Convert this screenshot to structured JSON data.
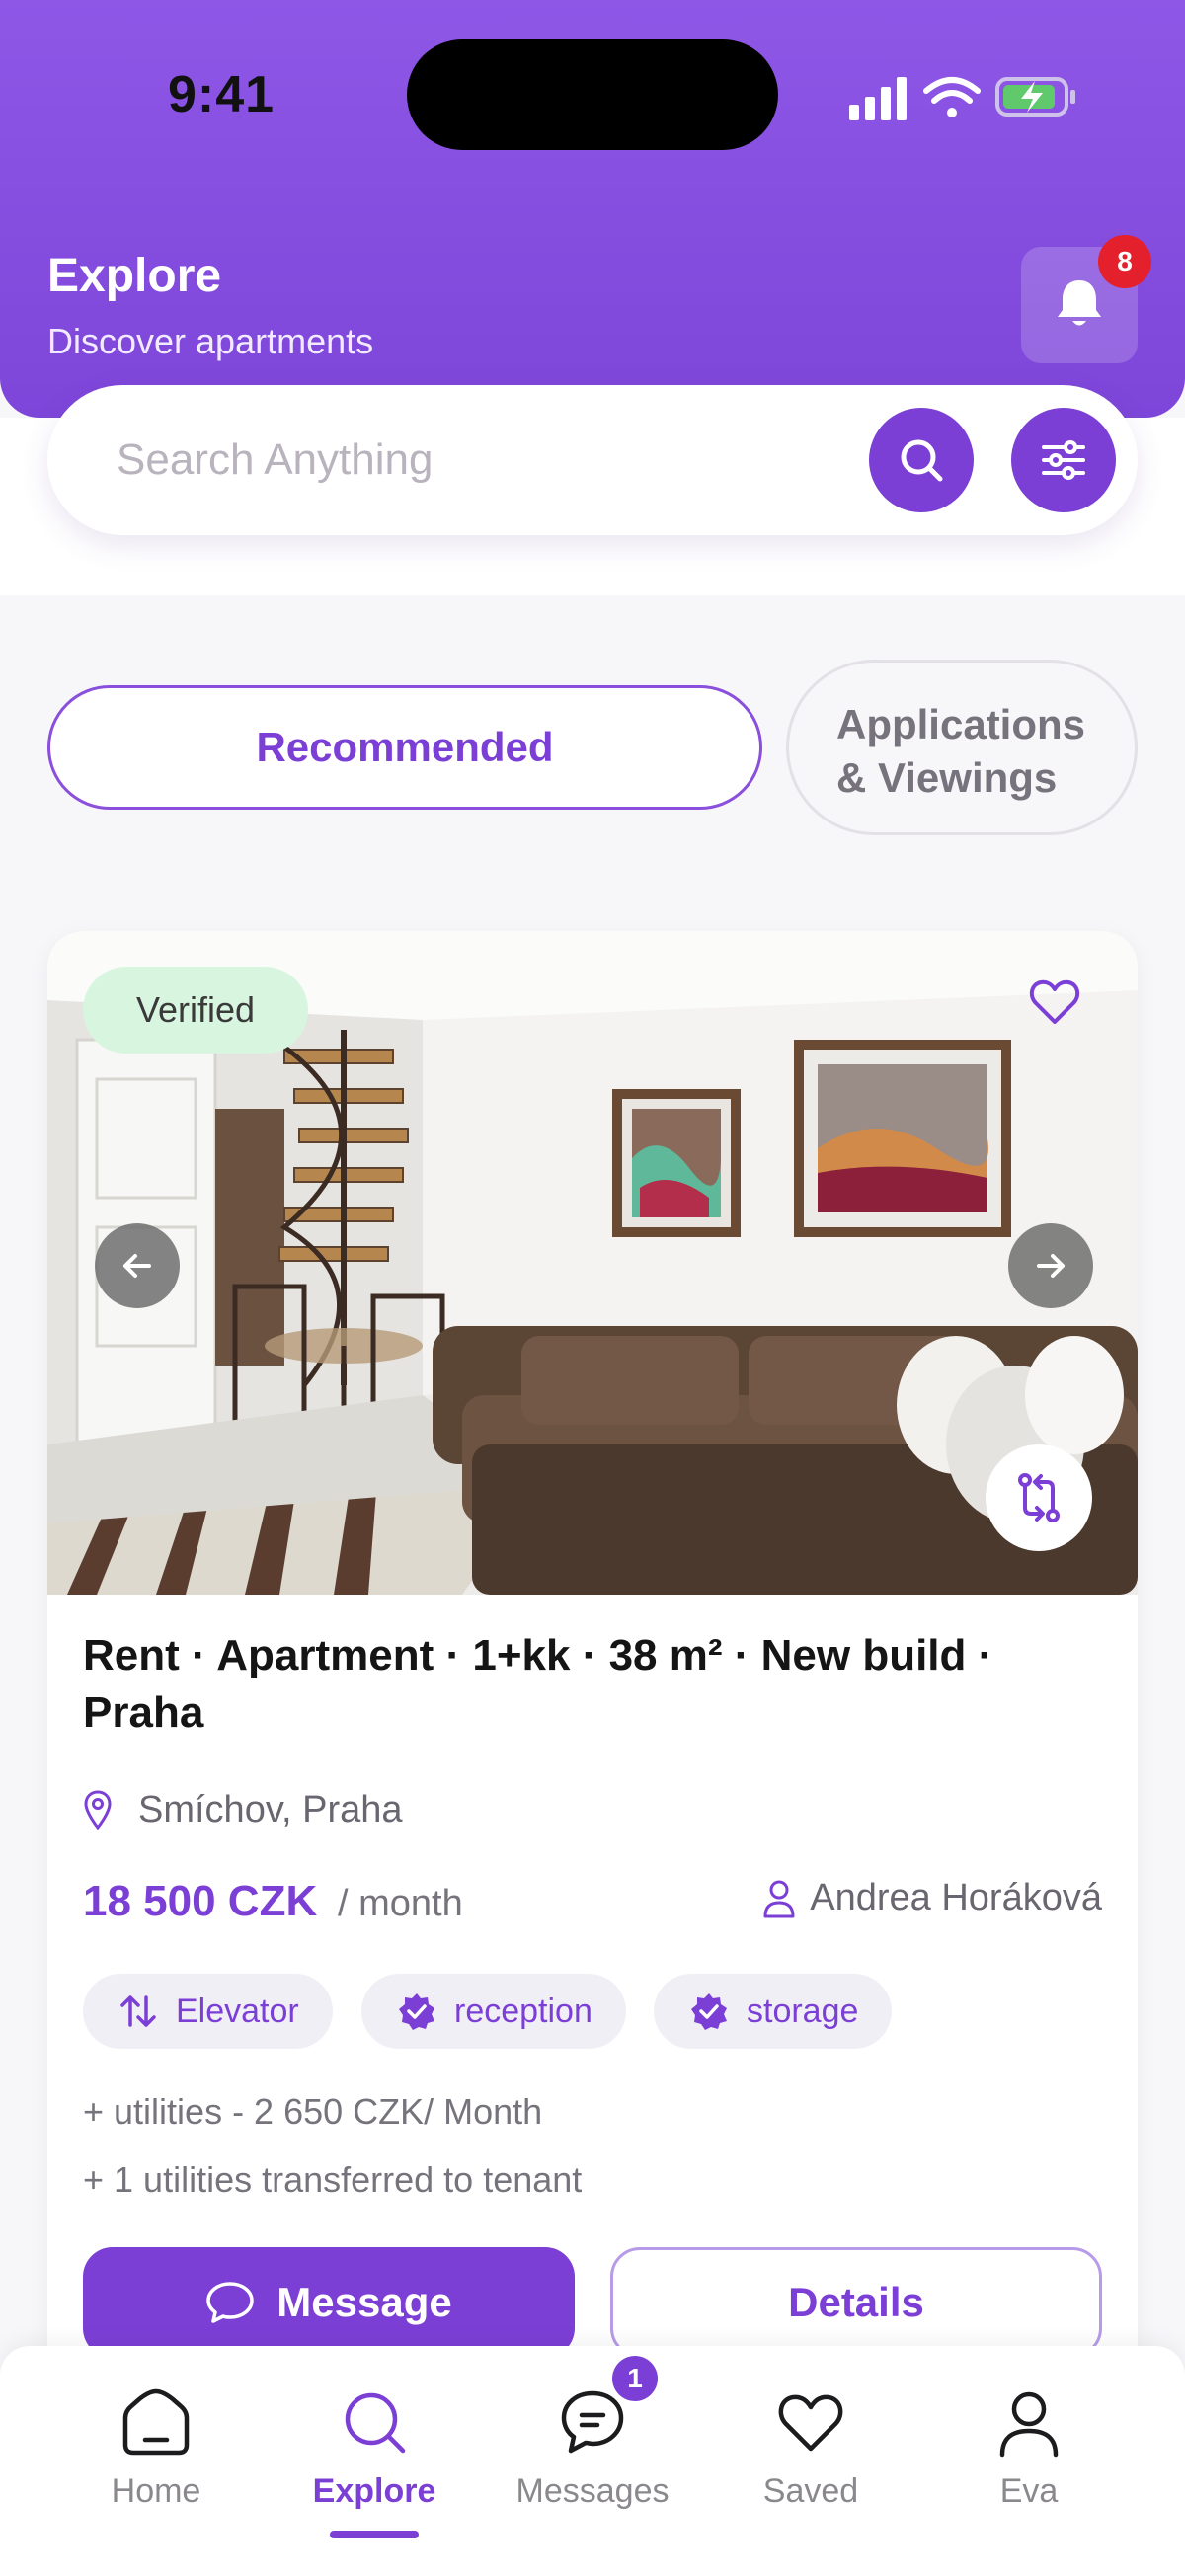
{
  "status_bar": {
    "time": "9:41"
  },
  "header": {
    "title": "Explore",
    "subtitle": "Discover apartments",
    "notification_count": "8"
  },
  "search": {
    "placeholder": "Search Anything"
  },
  "tabs": {
    "recommended": "Recommended",
    "applications": "Applications & Viewings",
    "applications_line1": "Applications",
    "applications_line2": "& Viewings"
  },
  "listing": {
    "badge": "Verified",
    "title": "Rent · Apartment · 1+kk · 38 m² · New build · Praha",
    "location": "Smíchov, Praha",
    "price": "18 500 CZK",
    "period": "/ month",
    "agent": "Andrea Horáková",
    "features": [
      "Elevator",
      "reception",
      "storage"
    ],
    "utilities_line1": "+ utilities - 2 650 CZK/ Month",
    "utilities_line2": "+ 1 utilities transferred to tenant",
    "message_label": "Message",
    "details_label": "Details"
  },
  "tabbar": {
    "items": [
      {
        "label": "Home",
        "icon": "home-icon"
      },
      {
        "label": "Explore",
        "icon": "search-icon"
      },
      {
        "label": "Messages",
        "icon": "chat-icon"
      },
      {
        "label": "Saved",
        "icon": "heart-icon"
      },
      {
        "label": "Eva",
        "icon": "user-icon"
      }
    ],
    "active": "Explore",
    "messages_badge": "1"
  },
  "colors": {
    "primary": "#7c3fd6",
    "header_gradient_top": "#8f57e6",
    "verified_bg": "#d8f5df",
    "badge_red": "#e3202b"
  }
}
